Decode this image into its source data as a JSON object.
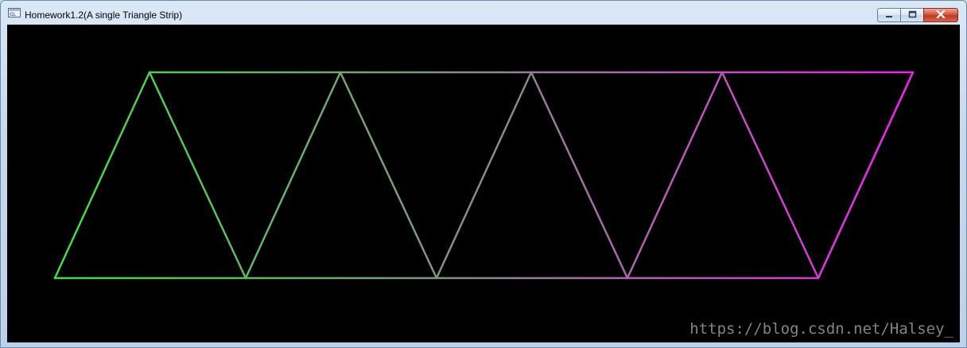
{
  "window": {
    "title": "Homework1.2(A single Triangle Strip)",
    "app_icon": "opengl-window-icon",
    "controls": {
      "minimize_icon": "minimize-icon",
      "maximize_icon": "maximize-icon",
      "close_icon": "close-icon"
    }
  },
  "canvas": {
    "background": "#000000",
    "start_color": "#44dd44",
    "end_color": "#ee22ee",
    "top_vertex_count": 5,
    "bottom_vertex_count": 5
  },
  "watermark": {
    "text": "https://blog.csdn.net/Halsey_"
  }
}
